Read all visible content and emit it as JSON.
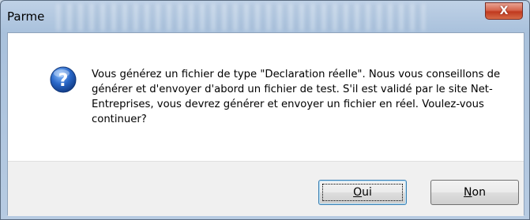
{
  "window": {
    "title": "Parme",
    "close_glyph": "X"
  },
  "icon": {
    "name": "question-icon",
    "glyph": "?",
    "color": "#2a68c8"
  },
  "message": {
    "text": "Vous générez un fichier de type \"Declaration réelle\". Nous vous conseillons de générer et d'envoyer d'abord un fichier de test. S'il est validé par le site Net-Entreprises, vous devrez générer et envoyer un fichier en réel. Voulez-vous continuer?"
  },
  "buttons": {
    "yes": {
      "accel": "O",
      "rest": "ui",
      "default": true
    },
    "no": {
      "accel": "N",
      "rest": "on",
      "default": false
    }
  }
}
